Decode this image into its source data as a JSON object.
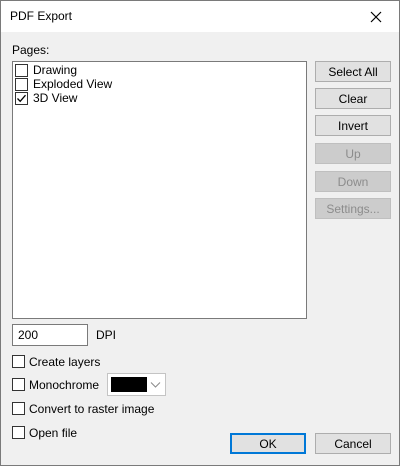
{
  "window": {
    "title": "PDF Export"
  },
  "pages": {
    "label": "Pages:",
    "items": [
      {
        "label": "Drawing",
        "checked": false
      },
      {
        "label": "Exploded View",
        "checked": false
      },
      {
        "label": "3D View",
        "checked": true
      }
    ]
  },
  "side_buttons": {
    "select_all": "Select All",
    "clear": "Clear",
    "invert": "Invert",
    "up": "Up",
    "down": "Down",
    "settings": "Settings..."
  },
  "dpi": {
    "value": "200",
    "unit_label": "DPI"
  },
  "options": {
    "create_layers": {
      "label": "Create layers",
      "checked": false
    },
    "monochrome": {
      "label": "Monochrome",
      "checked": false,
      "color": "#000000"
    },
    "convert_raster": {
      "label": "Convert to raster image",
      "checked": false
    },
    "open_file": {
      "label": "Open file",
      "checked": false
    }
  },
  "footer": {
    "ok": "OK",
    "cancel": "Cancel"
  }
}
